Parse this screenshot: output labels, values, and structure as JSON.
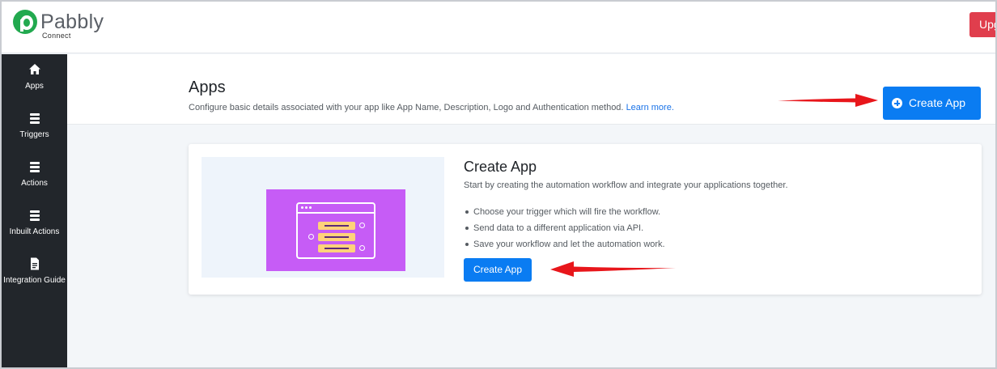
{
  "brand": {
    "name": "Pabbly",
    "product": "Connect",
    "color": "#22a94f"
  },
  "header": {
    "upgrade_label": "Upg",
    "upgrade_color": "#e03e4d"
  },
  "sidebar": {
    "items": [
      {
        "label": "Apps",
        "icon": "home-icon"
      },
      {
        "label": "Triggers",
        "icon": "list-icon"
      },
      {
        "label": "Actions",
        "icon": "list-icon"
      },
      {
        "label": "Inbuilt Actions",
        "icon": "list-icon"
      },
      {
        "label": "Integration Guide",
        "icon": "document-icon"
      }
    ]
  },
  "page": {
    "title": "Apps",
    "description": "Configure basic details associated with your app like App Name, Description, Logo and Authentication method.",
    "learn_more": "Learn more.",
    "create_button": "Create App"
  },
  "card": {
    "title": "Create App",
    "subtitle": "Start by creating the automation workflow and integrate your applications together.",
    "bullets": [
      "Choose your trigger which will fire the workflow.",
      "Send data to a different application via API.",
      "Save your workflow and let the automation work."
    ],
    "button": "Create App"
  },
  "colors": {
    "accent": "#0a7cf2",
    "sidebar_bg": "#22262b",
    "illustration": "#c65cf6",
    "annotation_arrow": "#e8161b"
  }
}
